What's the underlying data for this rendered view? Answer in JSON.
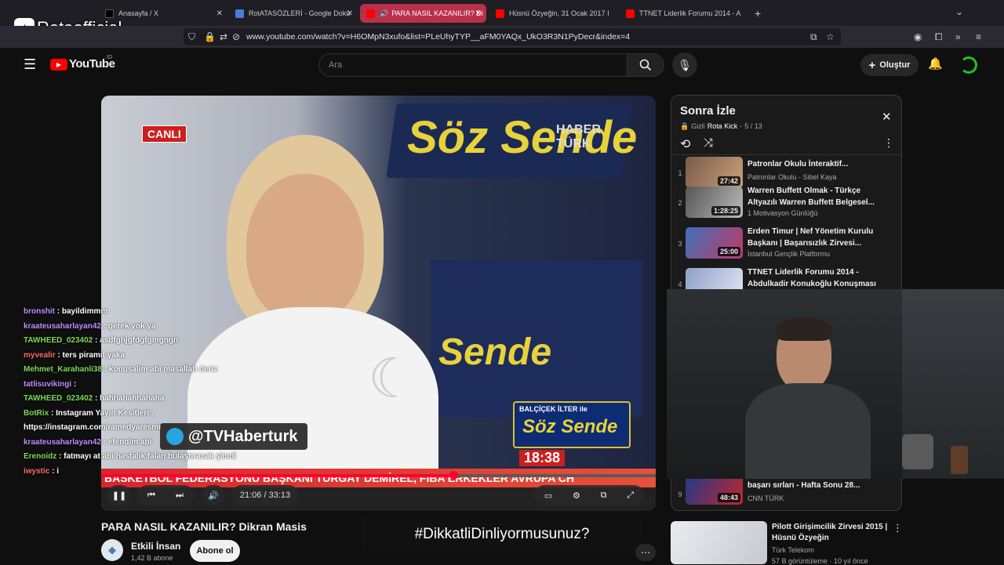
{
  "browser": {
    "tabs": [
      {
        "label": "Anasayfa / X",
        "icon": "x-icon"
      },
      {
        "label": "RotATASÖZLERİ - Google Dokü",
        "icon": "google-docs-icon"
      },
      {
        "label": "PARA NASIL KAZANILIR? Di",
        "icon": "youtube-icon",
        "active": true
      },
      {
        "label": "Hüsnü Özyeğin, 31 Ocak 2017 I",
        "icon": "youtube-icon"
      },
      {
        "label": "TTNET Liderlik Forumu 2014 - A",
        "icon": "youtube-icon"
      }
    ],
    "url": "www.youtube.com/watch?v=H6OMpN3xufo&list=PLeUhyTYP__aFM0YAQx_UkO3R3N1PyDecr&index=4",
    "overlay_brand": "Rotaofficial"
  },
  "youtube": {
    "logo": "YouTube",
    "region": "ID",
    "search_placeholder": "Ara",
    "create_label": "Oluştur"
  },
  "video": {
    "title": "PARA NASIL KAZANILIR? Dikran Masis",
    "time_current": "21:06",
    "time_total": "33:13",
    "progress_fraction": 0.635,
    "live_badge": "CANLI",
    "show_name": "Söz Sende",
    "channel_watermark": "HABER TÜRK",
    "twitter_handle": "@TVHaberturk",
    "host_name": "BALÇİÇEK İLTER ile",
    "show_logo": "Söz Sende",
    "clock": "18:38",
    "ticker": "BASKETBOL FEDERASYONU BAŞKANI TURGAY DEMİREL, FIBA ERKEKLER AVRUPA CH",
    "channel_name": "Etkili İnsan",
    "subscribers": "1,42 B abone",
    "subscribe_label": "Abone ol"
  },
  "playlist": {
    "title": "Sonra İzle",
    "privacy": "Gizli",
    "owner": "Rota Kick",
    "position": "5 / 13",
    "items": [
      {
        "num": "1",
        "title": "Patronlar Okulu İnteraktif...",
        "channel": "Patronlar Okulu - Sibel Kaya",
        "duration": "27:42"
      },
      {
        "num": "2",
        "title": "Warren Buffett Olmak - Türkçe Altyazılı Warren Buffett Belgesel...",
        "channel": "1 Motivasyon Günlüğü",
        "duration": "1:28:25"
      },
      {
        "num": "3",
        "title": "Erden Timur | Nef Yönetim Kurulu Başkanı | Başarısızlık Zirvesi...",
        "channel": "İstanbul Gençlik Platformu",
        "duration": "25:00"
      },
      {
        "num": "4",
        "title": "TTNET Liderlik Forumu 2014 - Abdulkadir Konukoğlu Konuşması",
        "channel": "",
        "duration": ""
      },
      {
        "num": "9",
        "title": "başarı sırları - Hafta Sonu 28...",
        "channel": "CNN TÜRK",
        "duration": "48:43"
      }
    ]
  },
  "recommendation": {
    "title": "Pilott Girişimcilik Zirvesi 2015 | Hüsnü Özyeğin",
    "channel": "Türk Telekom",
    "meta": "57 B görüntüleme · 10 yıl önce"
  },
  "chat": [
    {
      "user": "bronshit",
      "msg": ": bayildimmm",
      "color": "#c08bff"
    },
    {
      "user": "kraateusaharlayan42",
      "msg": ": gerek yok ya",
      "color": "#c08bff"
    },
    {
      "user": "TAWHEED_023402",
      "msg": ": asdfghjgfdgfgmgngn",
      "color": "#7ed957"
    },
    {
      "user": "myvealir",
      "msg": ": ters piramit yaka",
      "color": "#ff6b6b"
    },
    {
      "user": "Mehmet_Karahanli38",
      "msg": ": konusalim abi masallah deriz",
      "color": "#7ed957"
    },
    {
      "user": "tatlisuvikingi",
      "msg": ":",
      "color": "#c08bff"
    },
    {
      "user": "TAWHEED_023402",
      "msg": ": hahhahahhahaha",
      "color": "#7ed957"
    },
    {
      "user": "BotRix",
      "msg": ": Instagram Yayın Kesitleri :",
      "color": "#7ed957"
    },
    {
      "user": "",
      "msg": "https://instagram.com/ramedyaresmi",
      "color": "#fff"
    },
    {
      "user": "kraateusaharlayan42",
      "msg": ": efendim abi",
      "color": "#c08bff"
    },
    {
      "user": "Erenoidz",
      "msg": ": fatmayı at abi hastalık falan bulaştıracak şimdi",
      "color": "#7ed957"
    },
    {
      "user": "iwystic",
      "msg": ": i",
      "color": "#ff6b6b"
    }
  ],
  "overlay_hashtag": "#DikkatliDinliyormusunuz?"
}
